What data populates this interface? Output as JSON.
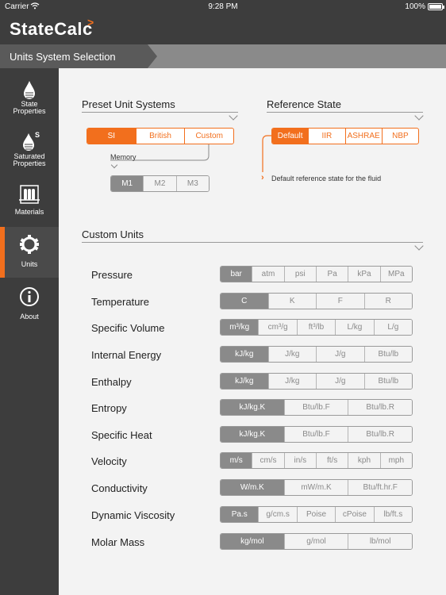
{
  "status_bar": {
    "carrier": "Carrier",
    "time": "9:28 PM",
    "battery": "100%"
  },
  "app": {
    "logo": "StateCalc",
    "logo_caret": ">"
  },
  "title_bar": {
    "label": "Units System Selection"
  },
  "sidebar": {
    "items": [
      {
        "label_line1": "State",
        "label_line2": "Properties",
        "icon": "drop-icon"
      },
      {
        "label_line1": "Saturated",
        "label_line2": "Properties",
        "icon": "saturated-drop-icon",
        "superscript": "S"
      },
      {
        "label_line1": "Materials",
        "label_line2": "",
        "icon": "test-tubes-icon"
      },
      {
        "label_line1": "Units",
        "label_line2": "",
        "icon": "gear-icon",
        "active": true
      },
      {
        "label_line1": "About",
        "label_line2": "",
        "icon": "info-icon"
      }
    ]
  },
  "preset": {
    "title": "Preset Unit Systems",
    "options": [
      "SI",
      "British",
      "Custom"
    ],
    "selected": "SI",
    "memory_label": "Memory",
    "memory_options": [
      "M1",
      "M2",
      "M3"
    ],
    "memory_selected": "M1"
  },
  "reference": {
    "title": "Reference State",
    "options": [
      "Default",
      "IIR",
      "ASHRAE",
      "NBP"
    ],
    "selected": "Default",
    "note": "Default reference state for the fluid"
  },
  "custom": {
    "title": "Custom Units",
    "rows": [
      {
        "label": "Pressure",
        "options": [
          "bar",
          "atm",
          "psi",
          "Pa",
          "kPa",
          "MPa"
        ],
        "selected": 0
      },
      {
        "label": "Temperature",
        "options": [
          "C",
          "K",
          "F",
          "R"
        ],
        "selected": 0
      },
      {
        "label": "Specific Volume",
        "options": [
          "m³/kg",
          "cm³/g",
          "ft³/lb",
          "L/kg",
          "L/g"
        ],
        "selected": 0
      },
      {
        "label": "Internal Energy",
        "options": [
          "kJ/kg",
          "J/kg",
          "J/g",
          "Btu/lb"
        ],
        "selected": 0
      },
      {
        "label": "Enthalpy",
        "options": [
          "kJ/kg",
          "J/kg",
          "J/g",
          "Btu/lb"
        ],
        "selected": 0
      },
      {
        "label": "Entropy",
        "options": [
          "kJ/kg.K",
          "Btu/lb.F",
          "Btu/lb.R"
        ],
        "selected": 0
      },
      {
        "label": "Specific Heat",
        "options": [
          "kJ/kg.K",
          "Btu/lb.F",
          "Btu/lb.R"
        ],
        "selected": 0
      },
      {
        "label": "Velocity",
        "options": [
          "m/s",
          "cm/s",
          "in/s",
          "ft/s",
          "kph",
          "mph"
        ],
        "selected": 0
      },
      {
        "label": "Conductivity",
        "options": [
          "W/m.K",
          "mW/m.K",
          "Btu/ft.hr.F"
        ],
        "selected": 0
      },
      {
        "label": "Dynamic Viscosity",
        "options": [
          "Pa.s",
          "g/cm.s",
          "Poise",
          "cPoise",
          "lb/ft.s"
        ],
        "selected": 0
      },
      {
        "label": "Molar Mass",
        "options": [
          "kg/mol",
          "g/mol",
          "lb/mol"
        ],
        "selected": 0
      }
    ]
  },
  "colors": {
    "accent": "#f26f1d",
    "sidebar": "#3d3d3d",
    "content": "#f3f3f3",
    "selected_gray": "#8a8a8a"
  }
}
